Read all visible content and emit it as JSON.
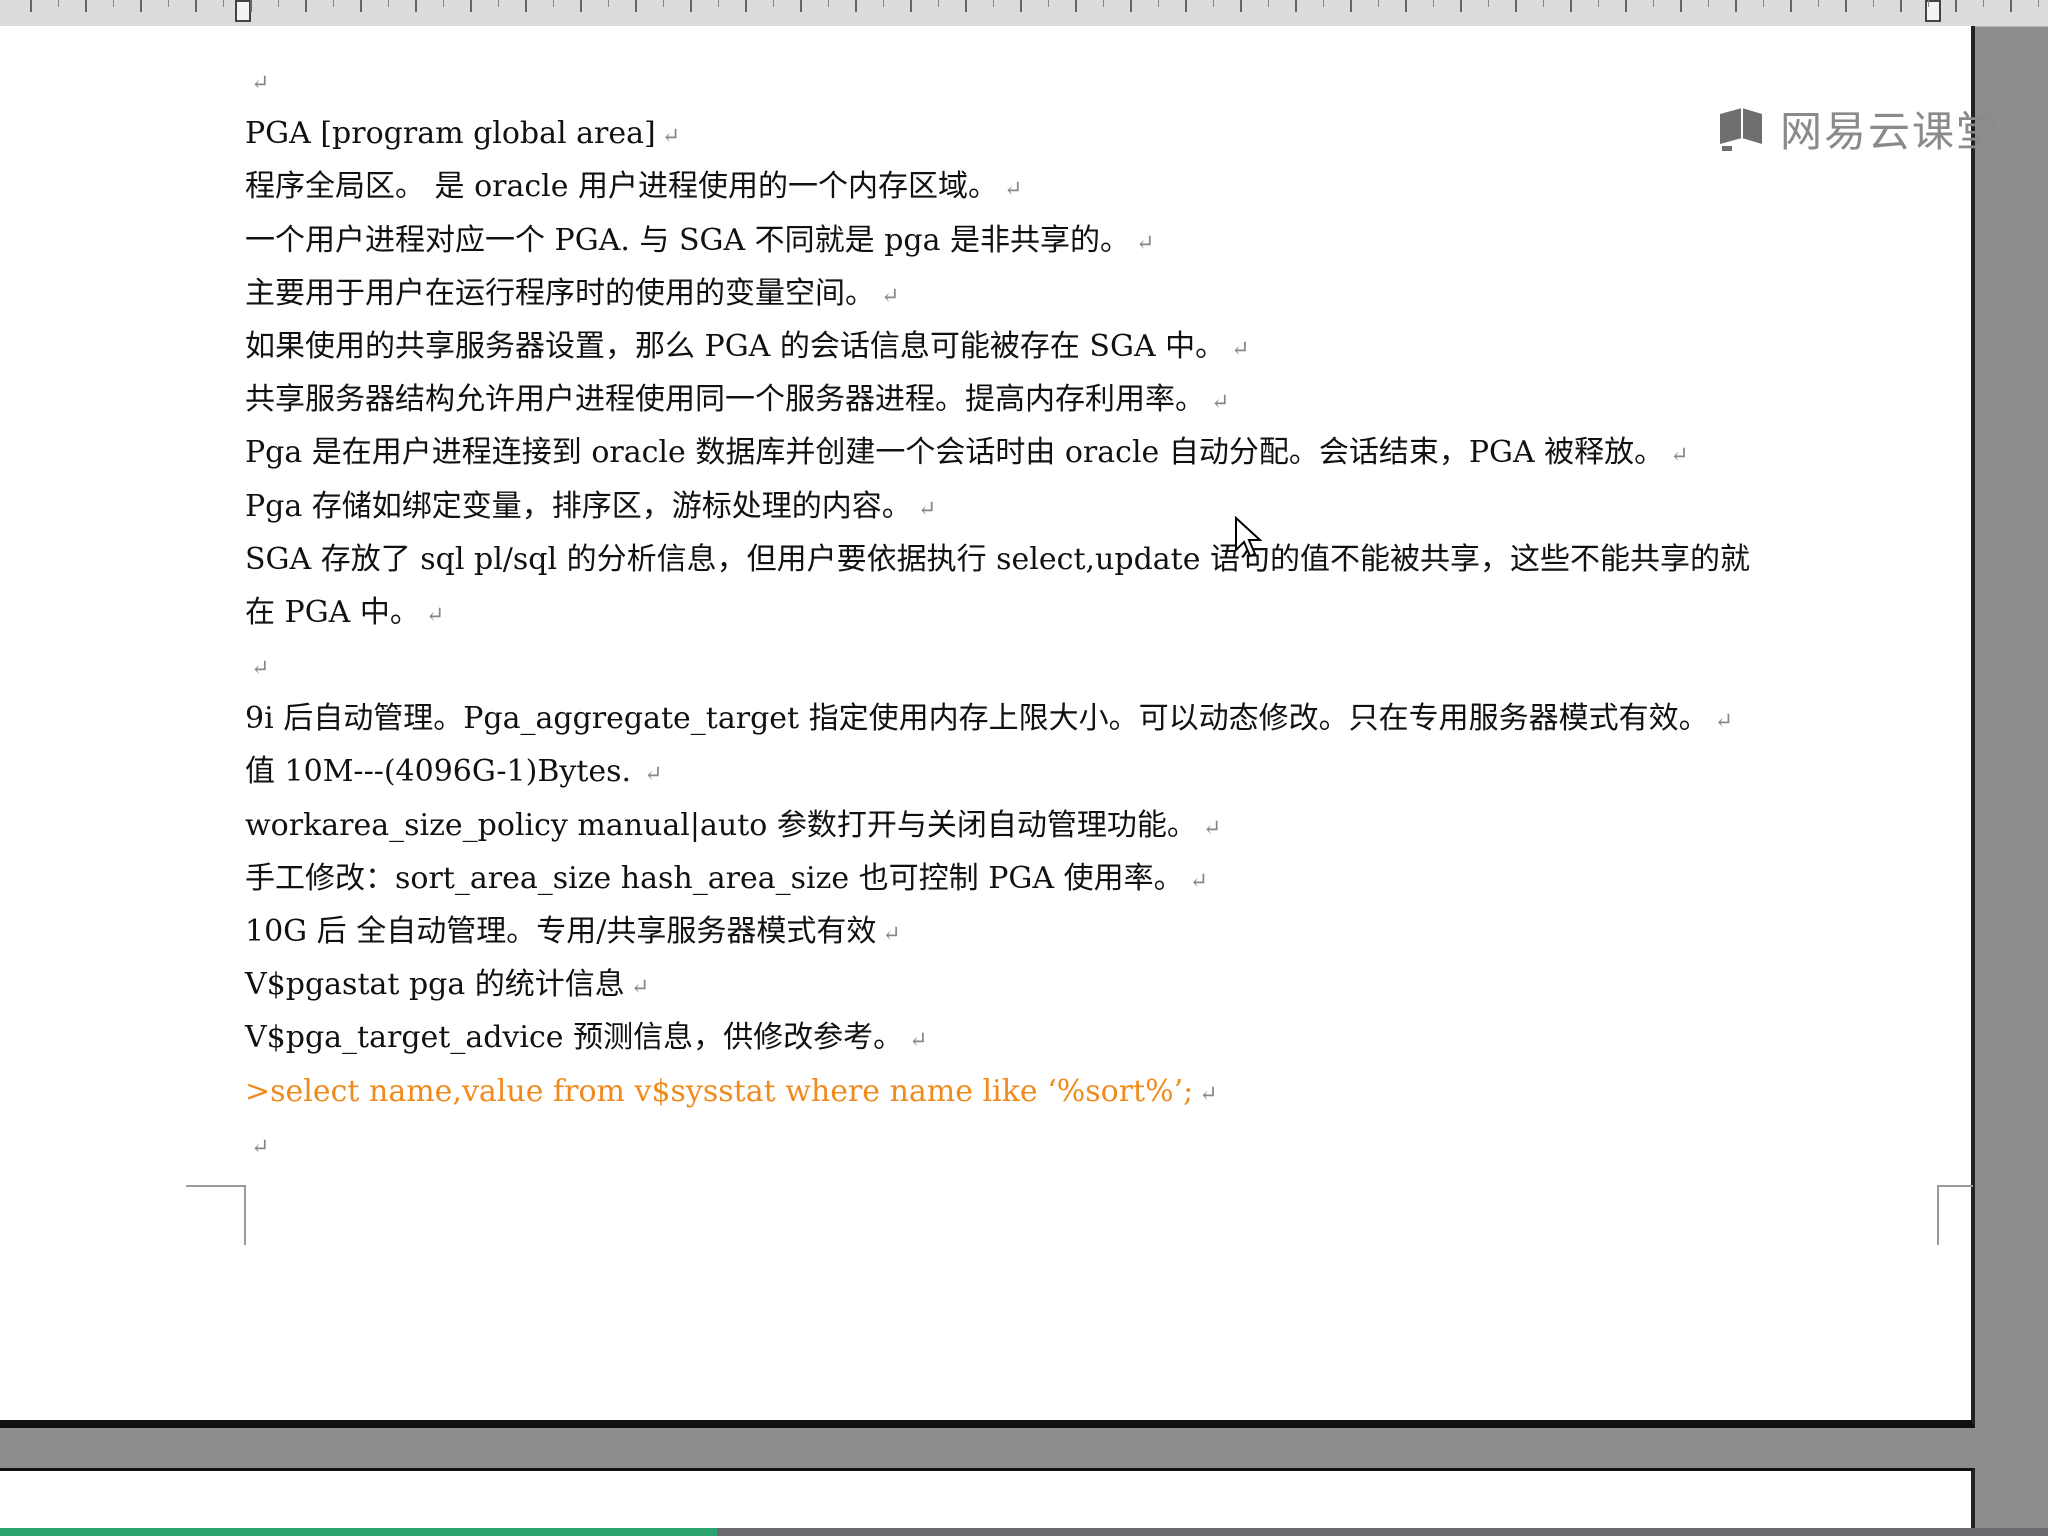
{
  "document": {
    "lines": [
      {
        "text": "",
        "mark": "↵"
      },
      {
        "text": "PGA [program global area]",
        "mark": "↵"
      },
      {
        "text": "程序全局区。  是 oracle 用户进程使用的一个内存区域。",
        "mark": "↵"
      },
      {
        "text": "一个用户进程对应一个 PGA. 与 SGA 不同就是 pga 是非共享的。",
        "mark": "↵"
      },
      {
        "text": "主要用于用户在运行程序时的使用的变量空间。",
        "mark": "↵"
      },
      {
        "text": "如果使用的共享服务器设置，那么 PGA 的会话信息可能被存在 SGA 中。",
        "mark": "↵"
      },
      {
        "text": "共享服务器结构允许用户进程使用同一个服务器进程。提高内存利用率。",
        "mark": "↵"
      },
      {
        "text": "Pga 是在用户进程连接到 oracle 数据库并创建一个会话时由 oracle 自动分配。会话结束，PGA 被释放。",
        "mark": "↵"
      },
      {
        "text": "Pga 存储如绑定变量，排序区，游标处理的内容。",
        "mark": "↵"
      },
      {
        "text": "SGA 存放了 sql pl/sql 的分析信息，但用户要依据执行 select,update 语句的值不能被共享，这些不能共享的就",
        "mark": ""
      },
      {
        "text": "在 PGA 中。",
        "mark": "↵"
      },
      {
        "text": "",
        "mark": "↵"
      },
      {
        "text": "9i 后自动管理。Pga_aggregate_target 指定使用内存上限大小。可以动态修改。只在专用服务器模式有效。",
        "mark": "↵"
      },
      {
        "text": "值 10M---(4096G-1)Bytes.",
        "mark": "   ↵"
      },
      {
        "text": "workarea_size_policy   manual|auto 参数打开与关闭自动管理功能。",
        "mark": "↵"
      },
      {
        "text": "手工修改：sort_area_size hash_area_size  也可控制 PGA 使用率。",
        "mark": "↵"
      },
      {
        "text": "10G 后  全自动管理。专用/共享服务器模式有效",
        "mark": "↵"
      },
      {
        "text": "V$pgastat      pga 的统计信息",
        "mark": "↵"
      },
      {
        "text": "V$pga_target_advice  预测信息，供修改参考。",
        "mark": "↵"
      },
      {
        "text": ">select name,value from v$sysstat where name like ‘%sort%’;",
        "mark": "↵"
      },
      {
        "text": "",
        "mark": "↵"
      }
    ]
  },
  "watermark": {
    "text": "网易云课堂"
  },
  "progress": {
    "fraction": 0.35
  }
}
